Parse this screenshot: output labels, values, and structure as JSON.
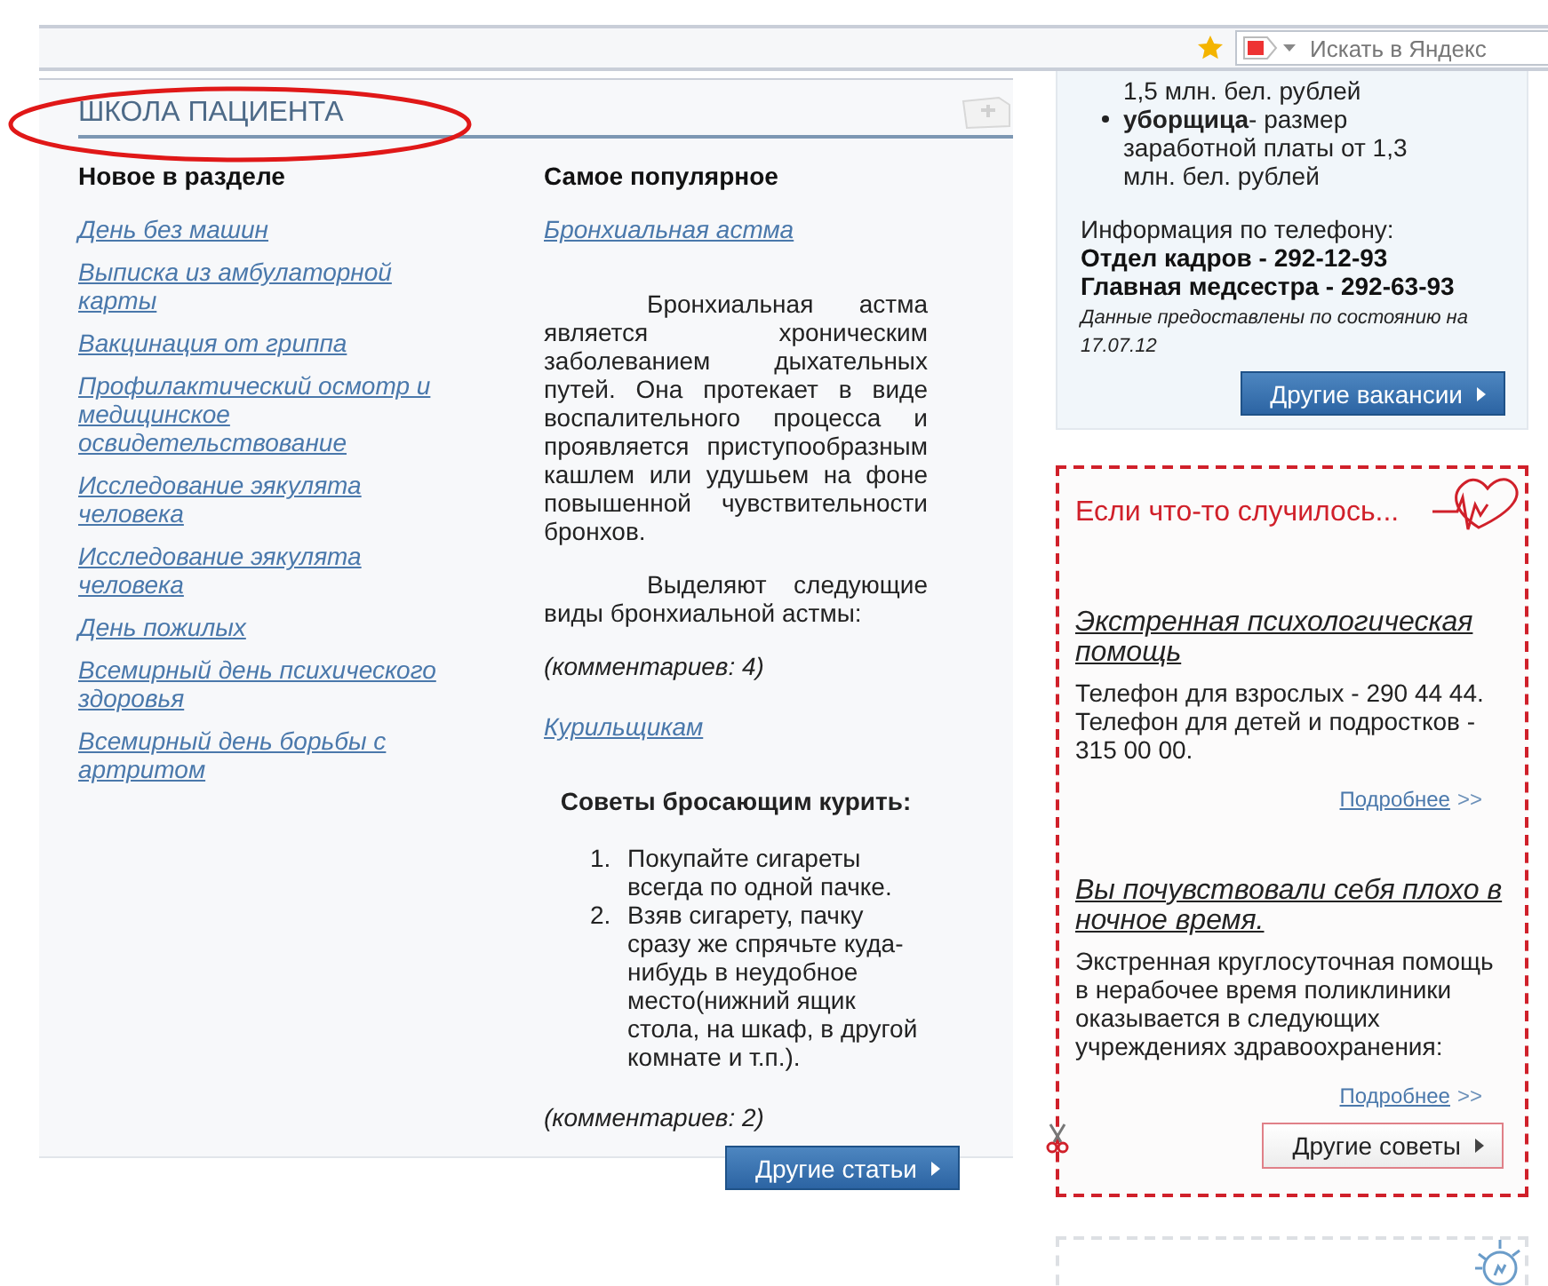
{
  "browser_bar": {
    "search_placeholder": "Искать в Яндекс"
  },
  "patient_school": {
    "title": "ШКОЛА ПАЦИЕНТА",
    "new_in_section": {
      "heading": "Новое в разделе",
      "links": [
        "День без машин",
        "Выписка из амбулаторной карты",
        "Вакцинация от гриппа",
        "Профилактический осмотр и медицинское освидетельствование",
        "Исследование эякулята человека",
        "Исследование эякулята человека",
        "День пожилых",
        "Всемирный день психического здоровья",
        "Всемирный день борьбы с артритом"
      ]
    },
    "most_popular": {
      "heading": "Самое популярное",
      "blocks": [
        {
          "kind": "link",
          "text": "Бронхиальная астма"
        },
        {
          "kind": "paragraph",
          "text": "Бронхиальная астма является хроническим заболеванием дыхательных путей. Она протекает в виде воспалительного процесса и проявляется приступообразным кашлем или удушьем на фоне повышенной чувствительности бронхов."
        },
        {
          "kind": "paragraph",
          "text": "Выделяют следующие виды бронхиальной астмы:"
        },
        {
          "kind": "comments",
          "text": "(комментариев: 4)"
        },
        {
          "kind": "link",
          "text": "Курильщикам"
        },
        {
          "kind": "subheading",
          "text": "Советы бросающим курить:"
        },
        {
          "kind": "list",
          "items": [
            {
              "number": "1.",
              "text": "Покупайте сигареты всегда по одной пачке."
            },
            {
              "number": "2.",
              "text": "Взяв сигарету, пачку сразу же спрячьте куда-нибудь в неудобное место(нижний ящик стола, на шкаф, в другой комнате и т.п.)."
            }
          ]
        },
        {
          "kind": "comments",
          "text": "(комментариев: 2)"
        }
      ]
    },
    "button": "Другие статьи"
  },
  "vacancies": {
    "items": [
      {
        "kind": "continuation",
        "text": "1,5 млн. бел. рублей"
      },
      {
        "kind": "bullet",
        "text": "**уборщица**- размер заработной платы от 1,3 млн. бел. рублей"
      }
    ],
    "phone_intro": "Информация по телефону:",
    "phones": [
      "Отдел кадров - 292-12-93",
      "Главная медсестра - 292-63-93"
    ],
    "note": "Данные предоставлены по состоянию на 17.07.12",
    "button": "Другие вакансии"
  },
  "emergency": {
    "title": "Если что-то случилось...",
    "sections": [
      {
        "heading": "Экстренная психологическая помощь",
        "text": "Телефон для взрослых - 290 44 44. Телефон для детей и подростков - 315 00 00.",
        "more": "Подробнее",
        "more_suffix": ">>"
      },
      {
        "heading": "Вы почувствовали себя плохо в ночное время.",
        "text": "Экстренная круглосуточная помощь в нерабочее время поликлиники оказывается в следующих учреждениях здравоохранения:",
        "more": "Подробнее",
        "more_suffix": ">>"
      }
    ],
    "button": "Другие советы"
  }
}
